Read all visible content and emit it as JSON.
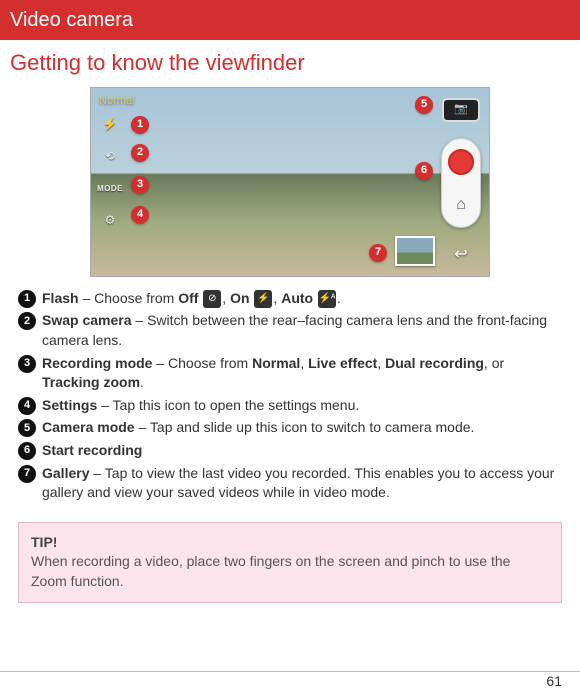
{
  "header": {
    "title": "Video camera",
    "subtitle": "Getting to know the viewfinder"
  },
  "viewfinder": {
    "mode_label": "Normal",
    "left_icons": [
      {
        "name": "flash-icon",
        "glyph": "⚡"
      },
      {
        "name": "swap-camera-icon",
        "glyph": "⟲"
      },
      {
        "name": "mode-icon",
        "glyph": "MODE"
      },
      {
        "name": "settings-icon",
        "glyph": "⚙"
      }
    ],
    "camera_switch_glyph": "📷",
    "home_glyph": "⌂",
    "back_glyph": "↩",
    "callouts": [
      "1",
      "2",
      "3",
      "4",
      "5",
      "6",
      "7"
    ]
  },
  "items": [
    {
      "n": "1",
      "label": "Flash",
      "text_before": " – Choose from ",
      "opts": [
        [
          "Off",
          "⊘"
        ],
        [
          "On",
          "⚡"
        ],
        [
          "Auto",
          "⚡ᴬ"
        ]
      ],
      "text_after": "."
    },
    {
      "n": "2",
      "label": "Swap camera",
      "text": " – Switch between the rear–facing camera lens and the front-facing camera lens."
    },
    {
      "n": "3",
      "label": "Recording mode",
      "text_before": " – Choose from ",
      "bold_list": [
        "Normal",
        "Live effect",
        "Dual recording",
        "Tracking zoom"
      ],
      "text_after": "."
    },
    {
      "n": "4",
      "label": "Settings",
      "text": " – Tap this icon to open the settings menu."
    },
    {
      "n": "5",
      "label": "Camera mode",
      "text": " – Tap and slide up this icon to switch to camera mode."
    },
    {
      "n": "6",
      "label": "Start recording",
      "text": ""
    },
    {
      "n": "7",
      "label": "Gallery",
      "text": " – Tap to view the last video you recorded. This enables you to access your gallery and view your saved videos while in video mode."
    }
  ],
  "tip": {
    "heading": "TIP!",
    "body": "When recording a video, place two fingers on the screen and pinch to use the Zoom function."
  },
  "page": "61"
}
